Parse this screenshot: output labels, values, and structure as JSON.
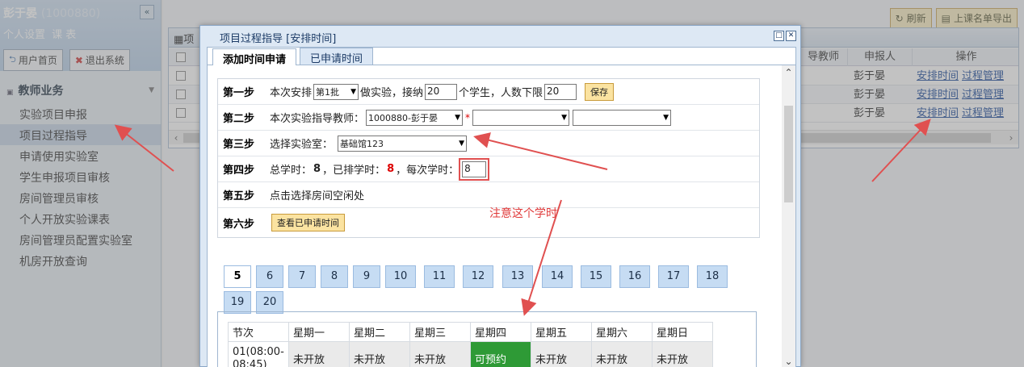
{
  "sidebar": {
    "user_name": "彭于晏",
    "user_id": "(1000880)",
    "links": [
      "个人设置",
      "课 表"
    ],
    "collapse_glyph": "«",
    "home_button": "用户首页",
    "logout_button": "退出系统",
    "section_title": "教师业务",
    "items": [
      "实验项目申报",
      "项目过程指导",
      "申请使用实验室",
      "学生申报项目审核",
      "房间管理员审核",
      "个人开放实验课表",
      "房间管理员配置实验室",
      "机房开放查询"
    ],
    "active_index": 1
  },
  "main": {
    "refresh_button": "刷新",
    "export_button": "上课名单导出",
    "grid_title": "项",
    "columns": [
      "导教师",
      "申报人",
      "操作"
    ],
    "rows": [
      {
        "applicant": "彭于晏",
        "link1": "安排时间",
        "link2": "过程管理"
      },
      {
        "applicant": "彭于晏",
        "link1": "安排时间",
        "link2": "过程管理"
      },
      {
        "applicant": "彭于晏",
        "link1": "安排时间",
        "link2": "过程管理"
      }
    ]
  },
  "dialog": {
    "title": "项目过程指导 [安排时间]",
    "tabs": [
      "添加时间申请",
      "已申请时间"
    ],
    "step1": {
      "label": "第一步",
      "text_a": "本次安排",
      "batch": "第1批",
      "text_b": "做实验，接纳",
      "capacity": "20",
      "text_c": "个学生，人数下限",
      "min_count": "20",
      "save": "保存"
    },
    "step2": {
      "label": "第二步",
      "text": "本次实验指导教师：",
      "teacher": "1000880-彭于晏",
      "required_mark": "*"
    },
    "step3": {
      "label": "第三步",
      "text": "选择实验室：",
      "lab": "基础馆123"
    },
    "step4": {
      "label": "第四步",
      "total_label": "总学时：",
      "total": "8",
      "sep1": "，",
      "scheduled_label": "已排学时：",
      "scheduled": "8",
      "sep2": "，",
      "per_label": "每次学时：",
      "per_value": "8"
    },
    "step5": {
      "label": "第五步",
      "text": "点击选择房间空闲处"
    },
    "step6": {
      "label": "第六步",
      "button": "查看已申请时间"
    },
    "note": "注意这个学时",
    "weeks": [
      "5",
      "6",
      "7",
      "8",
      "9",
      "10",
      "11",
      "12",
      "13",
      "14",
      "15",
      "16",
      "17",
      "18",
      "19",
      "20"
    ],
    "active_week": "5",
    "schedule": {
      "headers": [
        "节次",
        "星期一",
        "星期二",
        "星期三",
        "星期四",
        "星期五",
        "星期六",
        "星期日"
      ],
      "row": [
        "01(08:00-08:45)",
        "未开放",
        "未开放",
        "未开放",
        "可预约",
        "未开放",
        "未开放",
        "未开放"
      ]
    }
  },
  "colors": {
    "available": "#2e9a36",
    "annotation": "#e05050"
  }
}
